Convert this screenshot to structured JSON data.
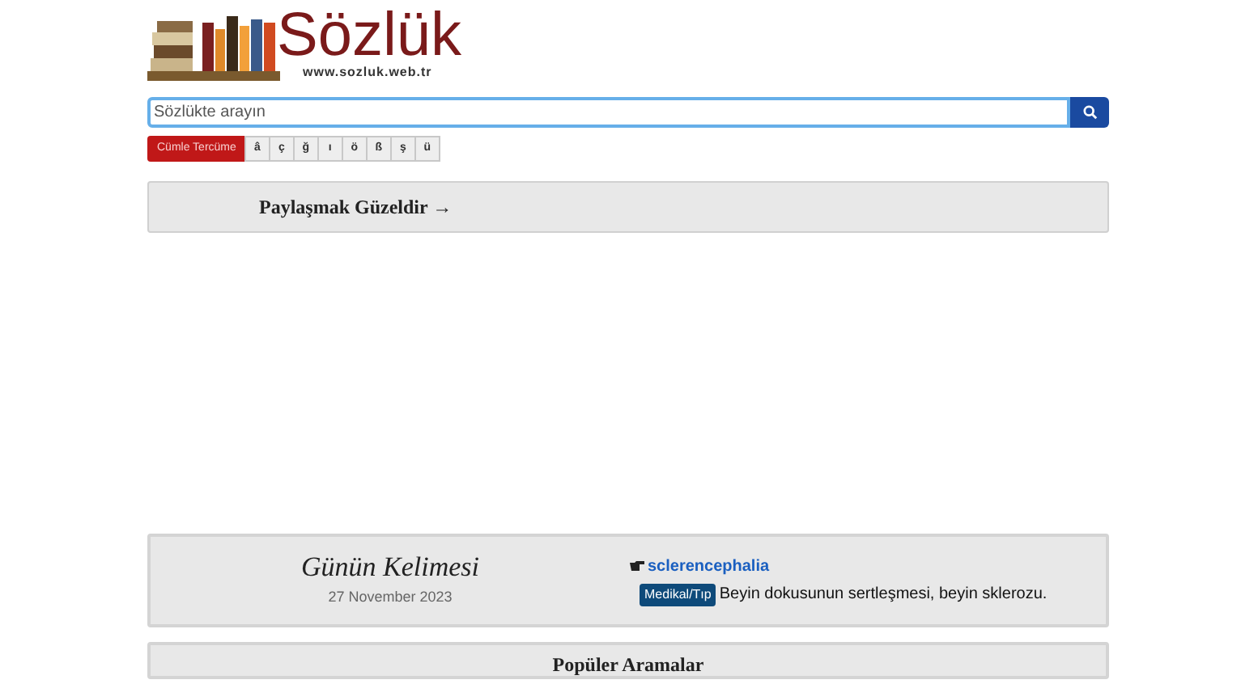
{
  "logo": {
    "title": "Sözlük",
    "url": "www.sozluk.web.tr"
  },
  "search": {
    "placeholder": "Sözlükte arayın"
  },
  "keyboard": {
    "translate_button": "Cümle Tercüme",
    "letters": [
      "â",
      "ç",
      "ğ",
      "ı",
      "ö",
      "ß",
      "ş",
      "ü"
    ]
  },
  "share_panel": {
    "title": "Paylaşmak Güzeldir →"
  },
  "word_of_day": {
    "heading": "Günün Kelimesi",
    "date": "27 November 2023",
    "word": "sclerencephalia",
    "tag": "Medikal/Tıp",
    "definition": "Beyin dokusunun sertleşmesi, beyin sklerozu."
  },
  "popular": {
    "title": "Popüler Aramalar"
  }
}
